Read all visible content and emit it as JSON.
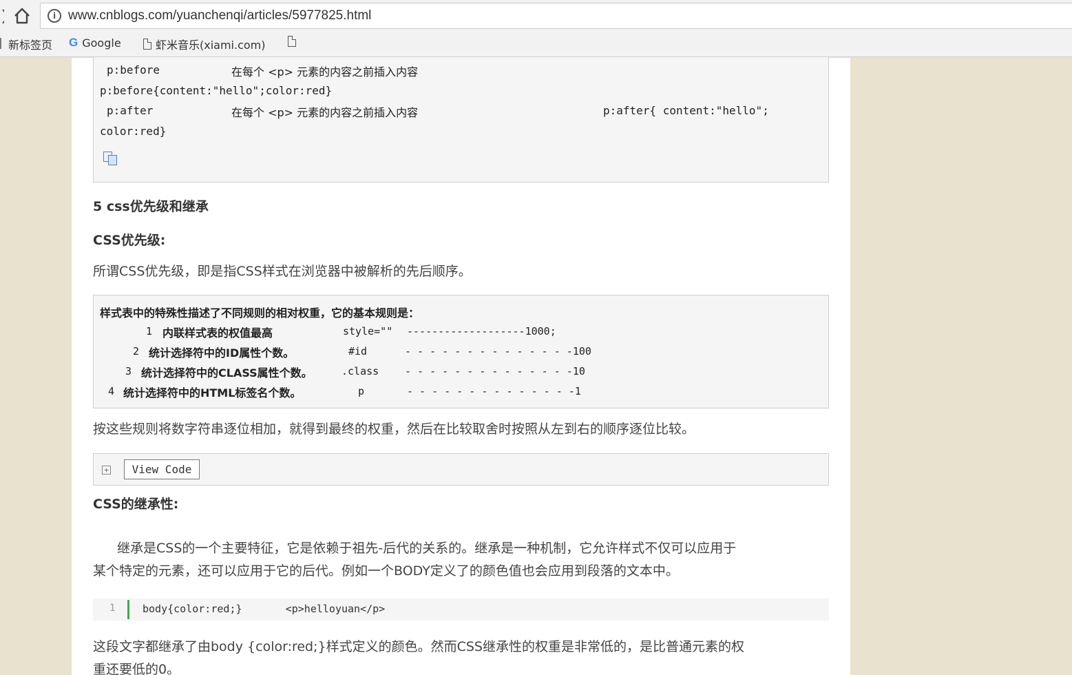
{
  "browser": {
    "url": "www.cnblogs.com/yuanchenqi/articles/5977825.html",
    "bookmarks": [
      "新标签页",
      "Google",
      "虾米音乐(xiami.com)"
    ]
  },
  "top_code": {
    "row1_sel": "p:before",
    "row1_desc": "在每个 <p> 元素的内容之前插入内容",
    "row2": "p:before{content:\"hello\";color:red}",
    "row3_sel": "p:after",
    "row3_desc": "在每个 <p> 元素的内容之前插入内容",
    "row3_code": "p:after{ content:\"hello\";",
    "row4": "color:red}"
  },
  "section": {
    "heading": "5 css优先级和继承",
    "sub1": "CSS优先级:",
    "para1": "所谓CSS优先级，即是指CSS样式在浏览器中被解析的先后顺序。"
  },
  "rules_box": {
    "intro": "样式表中的特殊性描述了不同规则的相对权重，它的基本规则是：",
    "rows": [
      {
        "num": "1",
        "desc": "内联样式表的权值最高",
        "sel": "style=\"\"",
        "weight": "-------------------1000;"
      },
      {
        "num": "2",
        "desc": "统计选择符中的ID属性个数。",
        "sel": "#id",
        "weight": "- - - - - - - - - - - - - -100"
      },
      {
        "num": "3",
        "desc": "统计选择符中的CLASS属性个数。",
        "sel": ".class",
        "weight": "- - - - - - - - - - - - - -10"
      },
      {
        "num": "4",
        "desc": "统计选择符中的HTML标签名个数。",
        "sel": "p",
        "weight": "- - - - - - - - - - - - - -1"
      }
    ]
  },
  "para2": "按这些规则将数字符串逐位相加，就得到最终的权重，然后在比较取舍时按照从左到右的顺序逐位比较。",
  "viewcode": {
    "label": "View Code"
  },
  "sub2": "CSS的继承性:",
  "para3_l1": "继承是CSS的一个主要特征，它是依赖于祖先-后代的关系的。继承是一种机制，它允许样式不仅可以应用于",
  "para3_l2": "某个特定的元素，还可以应用于它的后代。例如一个BODY定义了的颜色值也会应用到段落的文本中。",
  "snippet": {
    "line_no": "1",
    "code": "body{color:red;}       <p>helloyuan</p>"
  },
  "para4_l1": "这段文字都继承了由body {color:red;}样式定义的颜色。然而CSS继承性的权重是非常低的，是比普通元素的权",
  "para4_l2": "重还要低的0。"
}
